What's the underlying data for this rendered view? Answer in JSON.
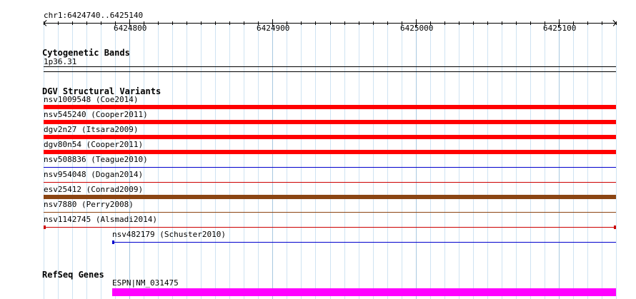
{
  "ruler": {
    "location_label": "chr1:6424740..6425140",
    "range": [
      6424740,
      6425140
    ],
    "ticks": [
      {
        "value": 6424800,
        "label": "6424800"
      },
      {
        "value": 6424900,
        "label": "6424900"
      },
      {
        "value": 6425000,
        "label": "6425000"
      },
      {
        "value": 6425100,
        "label": "6425100"
      }
    ]
  },
  "tracks": {
    "cytoband": {
      "title": "Cytogenetic Bands",
      "band_label": "1p36.31"
    },
    "dgv": {
      "title": "DGV Structural Variants",
      "variants": [
        {
          "label": "nsv1009548 (Coe2014)",
          "color": "#ff0000",
          "style": "thick"
        },
        {
          "label": "nsv545240 (Cooper2011)",
          "color": "#ff0000",
          "style": "thick"
        },
        {
          "label": "dgv2n27 (Itsara2009)",
          "color": "#ff0000",
          "style": "thick"
        },
        {
          "label": "dgv80n54 (Cooper2011)",
          "color": "#ff0000",
          "style": "thick"
        },
        {
          "label": "nsv508836 (Teague2010)",
          "color": "#0000cc",
          "style": "thin"
        },
        {
          "label": "nsv954048 (Dogan2014)",
          "color": "#cc0000",
          "style": "thin"
        },
        {
          "label": "esv25412 (Conrad2009)",
          "color": "#8b4513",
          "style": "thick"
        },
        {
          "label": "nsv7880 (Perry2008)",
          "color": "#8b4513",
          "style": "thin"
        },
        {
          "label": "nsv1142745 (Alsmadi2014)",
          "color": "#cc0000",
          "style": "capped"
        },
        {
          "label": "nsv482179 (Schuster2010)",
          "color": "#0000cc",
          "style": "capped-left",
          "start": 6424788
        }
      ]
    },
    "refseq": {
      "title": "RefSeq Genes",
      "genes": [
        {
          "label": "ESPN|NM_031475",
          "color": "#ff00ff",
          "start": 6424788
        }
      ]
    }
  }
}
